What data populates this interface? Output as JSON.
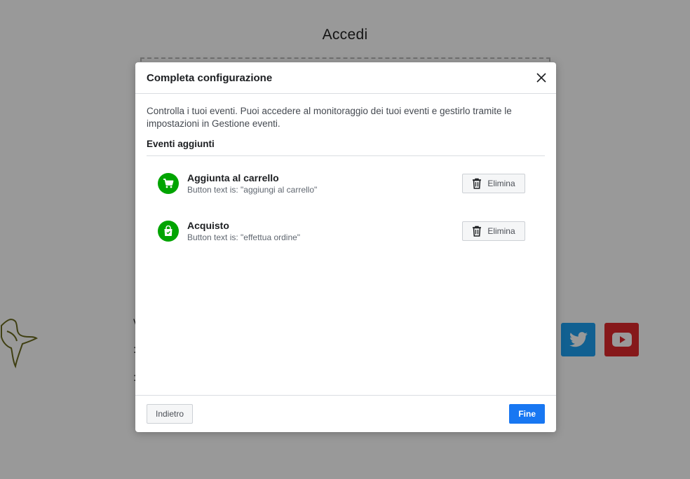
{
  "background": {
    "page_title": "Accedi",
    "side_chars": "v\n:\n:",
    "social": [
      {
        "name": "twitter-icon",
        "color": "#1da1f2"
      },
      {
        "name": "youtube-icon",
        "color": "#e0282c"
      }
    ]
  },
  "modal": {
    "title": "Completa configurazione",
    "close_icon": "close-icon",
    "description": "Controlla i tuoi eventi. Puoi accedere al monitoraggio dei tuoi eventi e gestirlo tramite le impostazioni in Gestione eventi.",
    "section_title": "Eventi aggiunti",
    "events": [
      {
        "name": "Aggiunta al carrello",
        "subtitle": "Button text is: \"aggiungi al carrello\"",
        "icon": "cart-icon",
        "delete_label": "Elimina"
      },
      {
        "name": "Acquisto",
        "subtitle": "Button text is: \"effettua ordine\"",
        "icon": "shopping-bag-icon",
        "delete_label": "Elimina"
      }
    ],
    "back_label": "Indietro",
    "done_label": "Fine"
  },
  "colors": {
    "accent": "#1877f2",
    "event_icon_bg": "#00a400"
  }
}
